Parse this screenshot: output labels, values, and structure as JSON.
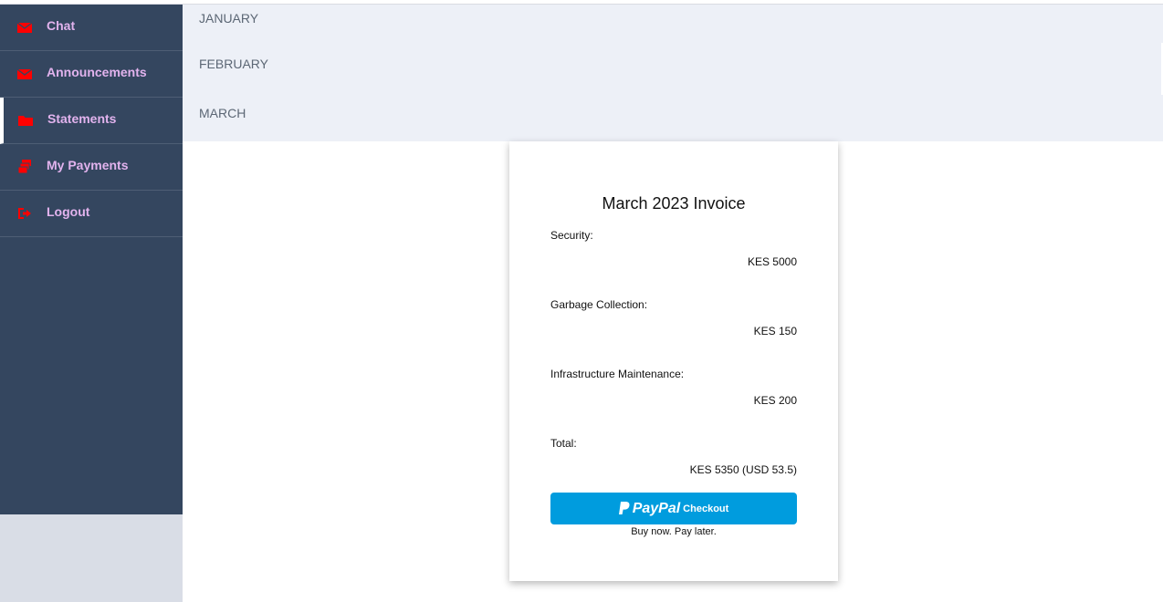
{
  "sidebar": {
    "items": [
      {
        "label": "Chat",
        "icon": "envelope-icon"
      },
      {
        "label": "Announcements",
        "icon": "envelope-icon"
      },
      {
        "label": "Statements",
        "icon": "folder-icon"
      },
      {
        "label": "My Payments",
        "icon": "money-icon"
      },
      {
        "label": "Logout",
        "icon": "sign-out-icon"
      }
    ],
    "active": "Statements"
  },
  "months": [
    "JANUARY",
    "FEBRUARY",
    "MARCH"
  ],
  "invoice": {
    "title": "March 2023 Invoice",
    "items": [
      {
        "label": "Security:",
        "value": "KES 5000"
      },
      {
        "label": "Garbage Collection:",
        "value": "KES 150"
      },
      {
        "label": "Infrastructure Maintenance:",
        "value": "KES 200"
      },
      {
        "label": "Total:",
        "value": "KES 5350 (USD 53.5)"
      }
    ],
    "paypal": {
      "brand": "PayPal",
      "action": "Checkout",
      "tagline": "Buy now. Pay later."
    }
  },
  "colors": {
    "sidebar": "#34465f",
    "sidebar_text": "#e2b3ee",
    "icon": "#ff0000",
    "paypal": "#009cde",
    "months_bg": "#edf0f7"
  }
}
